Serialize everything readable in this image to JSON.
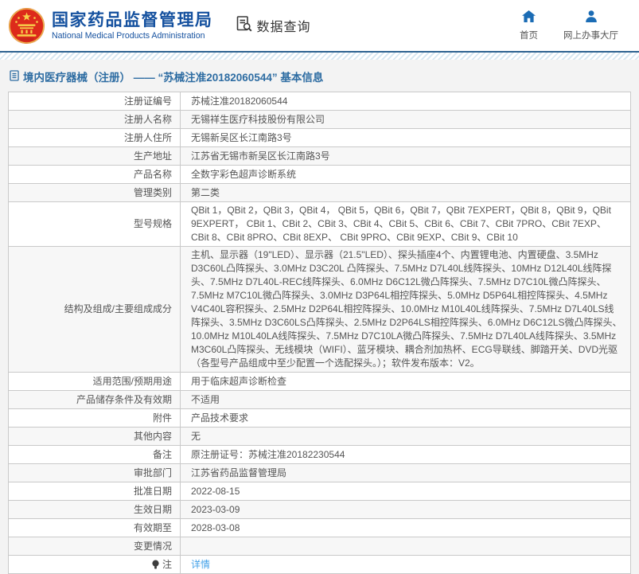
{
  "header": {
    "logo": {
      "title_cn": "国家药品监督管理局",
      "title_en": "National Medical Products Administration"
    },
    "section_label": "数据查询",
    "nav": [
      {
        "label": "首页",
        "icon": "home-icon"
      },
      {
        "label": "网上办事大厅",
        "icon": "person-icon"
      }
    ]
  },
  "page": {
    "title": "境内医疗器械（注册） —— “苏械注准20182060544” 基本信息"
  },
  "table": {
    "rows": [
      {
        "label": "注册证编号",
        "value": "苏械注准20182060544"
      },
      {
        "label": "注册人名称",
        "value": "无锡祥生医疗科技股份有限公司"
      },
      {
        "label": "注册人住所",
        "value": "无锡新吴区长江南路3号"
      },
      {
        "label": "生产地址",
        "value": "江苏省无锡市新吴区长江南路3号"
      },
      {
        "label": "产品名称",
        "value": "全数字彩色超声诊断系统"
      },
      {
        "label": "管理类别",
        "value": "第二类"
      },
      {
        "label": "型号规格",
        "value": "QBit 1，QBit 2，QBit 3，QBit 4， QBit 5，QBit 6，QBit 7，QBit 7EXPERT，QBit 8，QBit 9，QBit 9EXPERT， CBit 1、CBit 2、CBit 3、CBit 4、CBit 5、CBit 6、CBit 7、CBit 7PRO、CBit 7EXP、CBit 8、CBit 8PRO、CBit 8EXP、 CBit 9PRO、CBit 9EXP、CBit 9、CBit 10"
      },
      {
        "label": "结构及组成/主要组成成分",
        "value": "主机、显示器（19\"LED）、显示器（21.5\"LED）、探头插座4个、内置锂电池、内置硬盘、3.5MHz D3C60L凸阵探头、3.0MHz D3C20L 凸阵探头、7.5MHz D7L40L线阵探头、10MHz D12L40L线阵探头、7.5MHz D7L40L-REC线阵探头、6.0MHz D6C12L微凸阵探头、7.5MHz D7C10L微凸阵探头、7.5MHz M7C10L微凸阵探头、3.0MHz D3P64L相控阵探头、5.0MHz D5P64L相控阵探头、4.5MHz V4C40L容积探头、2.5MHz D2P64L相控阵探头、10.0MHz M10L40L线阵探头、7.5MHz D7L40LS线阵探头、3.5MHz D3C60LS凸阵探头、2.5MHz D2P64LS相控阵探头、6.0MHz D6C12LS微凸阵探头、10.0MHz M10L40LA线阵探头、7.5MHz D7C10LA微凸阵探头、7.5MHz D7L40LA线阵探头、3.5MHz M3C60L凸阵探头、无线模块（WIFI）、蓝牙模块、耦合剂加热杯、ECG导联线、脚踏开关、DVD光驱（各型号产品组成中至少配置一个选配探头。）；软件发布版本：V2。"
      },
      {
        "label": "适用范围/预期用途",
        "value": "用于临床超声诊断检查"
      },
      {
        "label": "产品储存条件及有效期",
        "value": "不适用"
      },
      {
        "label": "附件",
        "value": "产品技术要求"
      },
      {
        "label": "其他内容",
        "value": "无"
      },
      {
        "label": "备注",
        "value": "原注册证号：苏械注准20182230544"
      },
      {
        "label": "审批部门",
        "value": "江苏省药品监督管理局"
      },
      {
        "label": "批准日期",
        "value": "2022-08-15"
      },
      {
        "label": "生效日期",
        "value": "2023-03-09"
      },
      {
        "label": "有效期至",
        "value": "2028-03-08"
      },
      {
        "label": "变更情况",
        "value": ""
      },
      {
        "label": "注",
        "icon": "note-icon",
        "value": "详情",
        "link": true
      }
    ]
  },
  "colors": {
    "logo_blue": "#15519f",
    "nav_icon_blue": "#1b6cb5",
    "title_blue": "#2d6ca2",
    "link_blue": "#41a0e8",
    "divider_blue": "#2f6391",
    "table_border": "#c9c9c9",
    "row_stripe": "#f7f7f7",
    "text": "#555555",
    "emblem_red": "#dd2a1b",
    "emblem_gold": "#f7d04a"
  }
}
